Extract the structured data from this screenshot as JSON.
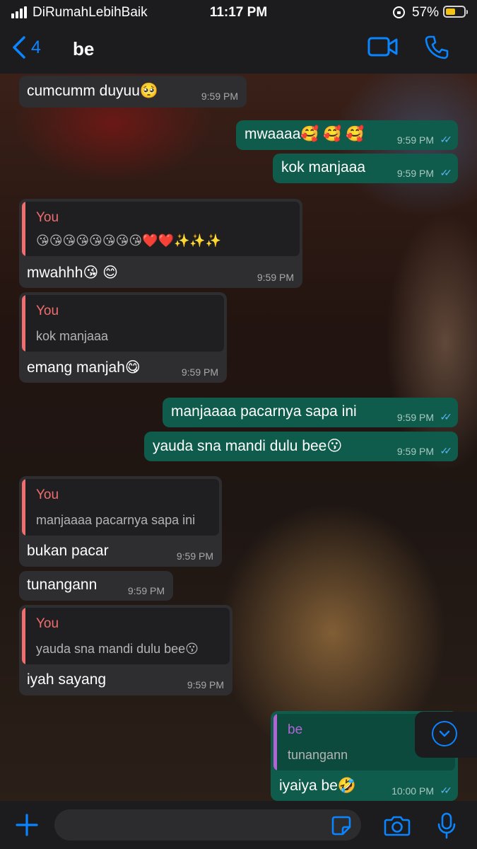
{
  "status_bar": {
    "carrier": "DiRumahLebihBaik",
    "time": "11:17 PM",
    "battery_percent": "57%",
    "battery_level": 0.57,
    "signal_bars": 4
  },
  "header": {
    "back_count": "4",
    "contact_name": "be",
    "icons": {
      "back": "chevron-left-icon",
      "video": "video-call-icon",
      "call": "phone-icon"
    }
  },
  "messages": [
    {
      "dir": "in",
      "text": "cumcumm duyuu🥺",
      "time": "9:59 PM"
    },
    {
      "dir": "out",
      "text": "mwaaaa🥰 🥰 🥰",
      "time": "9:59 PM",
      "status": "read"
    },
    {
      "dir": "out",
      "text": "kok manjaaa",
      "time": "9:59 PM",
      "status": "read"
    },
    {
      "dir": "in",
      "reply_to": {
        "name": "You",
        "text": "😘😘😘😘😘😘😘😘❤️❤️✨✨✨"
      },
      "text": "mwahhh😘 😊",
      "time": "9:59 PM"
    },
    {
      "dir": "in",
      "reply_to": {
        "name": "You",
        "text": "kok manjaaa"
      },
      "text": "emang manjah😋",
      "time": "9:59 PM"
    },
    {
      "dir": "out",
      "text": "manjaaaa pacarnya sapa ini",
      "time": "9:59 PM",
      "status": "read"
    },
    {
      "dir": "out",
      "text": "yauda sna mandi dulu bee😗",
      "time": "9:59 PM",
      "status": "read"
    },
    {
      "dir": "in",
      "reply_to": {
        "name": "You",
        "text": "manjaaaa pacarnya sapa ini"
      },
      "text": "bukan pacar",
      "time": "9:59 PM"
    },
    {
      "dir": "in",
      "text": "tunangann",
      "time": "9:59 PM"
    },
    {
      "dir": "in",
      "reply_to": {
        "name": "You",
        "text": "yauda sna mandi dulu bee😗"
      },
      "text": "iyah sayang",
      "time": "9:59 PM"
    },
    {
      "dir": "out",
      "reply_to": {
        "name": "be",
        "text": "tunangann"
      },
      "text": "iyaiya be🤣",
      "time": "10:00 PM",
      "status": "read"
    }
  ],
  "read_tick": "✓✓",
  "input_bar": {
    "text": "",
    "icons": {
      "add": "plus-icon",
      "sticker": "sticker-icon",
      "camera": "camera-icon",
      "mic": "microphone-icon"
    }
  },
  "scroll_button": {
    "icon": "chevron-down-icon"
  },
  "colors": {
    "accent": "#0a84ff",
    "incoming_bubble": "#2e2d30",
    "outgoing_bubble": "#0f5c4c",
    "reply_you": "#f06e6e",
    "reply_be": "#b165d4",
    "read_tick": "#5bb5f5",
    "battery": "#f3c416"
  }
}
